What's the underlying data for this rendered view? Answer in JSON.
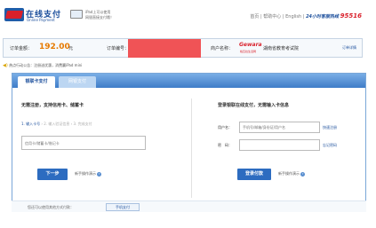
{
  "header": {
    "logo_cn": "在线支付",
    "logo_en": "Online Payment",
    "ipad_promo_line1": "iPad上可以使用",
    "ipad_promo_line2": "网银直接支付哦！",
    "nav": [
      "首页",
      "帮助中心",
      "English"
    ],
    "hotline_label": "24小时客服热线",
    "hotline_number": "95516"
  },
  "order": {
    "amount_label": "订单金额：",
    "amount": "192.00",
    "currency": "元",
    "order_no_label": "订单编号：",
    "merchant_label": "商户名称：",
    "merchant_logo": "Gewara",
    "merchant_logo_sub": "格瓦拉生活网",
    "merchant_name": "湖南省教育考试院",
    "detail_link": "订单详情"
  },
  "notice": {
    "text": "热点行动公告：注册送优惠，消费赢iPad mini"
  },
  "tabs": [
    {
      "label": "银联卡支付",
      "active": true
    },
    {
      "label": "网银支付",
      "active": false
    }
  ],
  "left": {
    "title": "无需注册，支持信用卡、储蓄卡",
    "steps": [
      "1. 输入卡号",
      "2. 输入验证信息",
      "3. 完成支付"
    ],
    "card_placeholder": "信用卡/储蓄卡/借记卡",
    "next_button": "下一步",
    "guide": "新手操作演示"
  },
  "right": {
    "title": "登录银联在线支付，无需输入卡信息",
    "username_label": "用户名：",
    "username_placeholder": "手机号/邮箱/身份证/用户名",
    "register_link": "快速注册",
    "password_label": "密　码：",
    "forgot_link": "忘记密码",
    "login_button": "登录付款",
    "guide": "新手操作演示"
  },
  "bottom": {
    "text": "您还可以使用其他方式付款：",
    "chip": "手机支付"
  },
  "colors": {
    "brand_blue": "#1c4f9c",
    "amount_orange": "#e67a00",
    "redaction": "#f05356",
    "button_blue": "#2d6cc0"
  }
}
